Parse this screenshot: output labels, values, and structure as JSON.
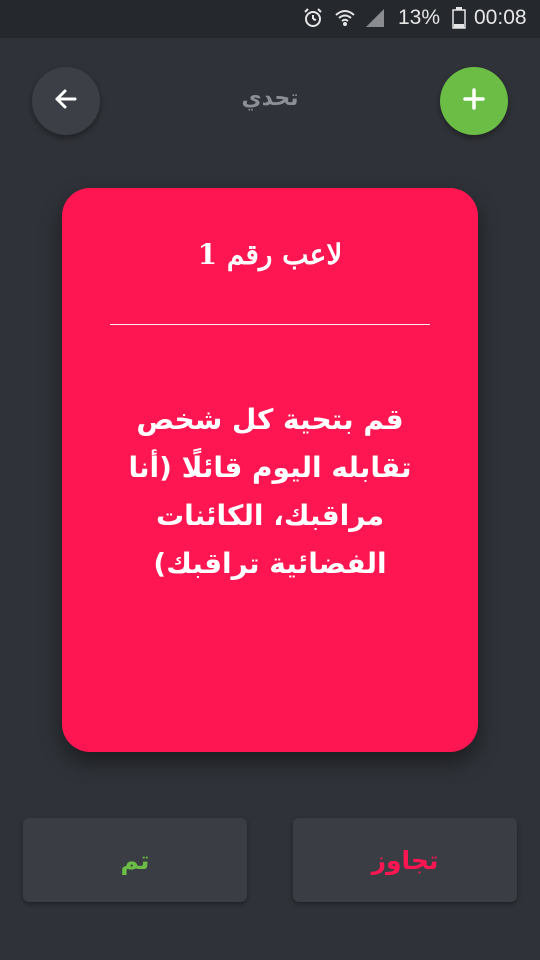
{
  "status_bar": {
    "battery_percent": "13%",
    "time": "00:08",
    "icons": [
      "alarm-icon",
      "wifi-icon",
      "signal-icon",
      "battery-icon"
    ]
  },
  "header": {
    "title": "تحدي",
    "back_icon": "arrow-left-icon",
    "add_icon": "plus-icon"
  },
  "card": {
    "player": "لاعب رقم 1",
    "challenge": "قم بتحية كل شخص تقابله اليوم قائلًا (أنا مراقبك، الكائنات الفضائية تراقبك)"
  },
  "buttons": {
    "done": "تم",
    "skip": "تجاوز"
  },
  "colors": {
    "background": "#2f3238",
    "card": "#fd1651",
    "accent_green": "#6cbd45",
    "accent_red": "#fd1651"
  }
}
